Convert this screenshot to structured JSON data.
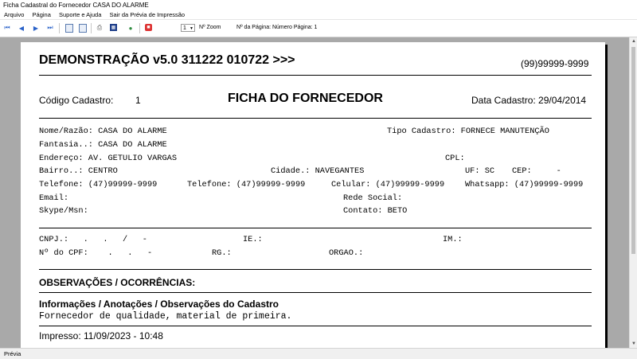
{
  "window": {
    "title": "Ficha Cadastral do Fornecedor CASA DO ALARME"
  },
  "menu": [
    "Arquivo",
    "Página",
    "Suporte e Ajuda",
    "Sair da Prévia de Impressão"
  ],
  "toolbar": {
    "zoom_value": "1",
    "zoom_label": "Nº Zoom",
    "page_label": "Nº da Página: Número Página: 1"
  },
  "report": {
    "header_title": "DEMONSTRAÇÃO v5.0 311222 010722 >>>",
    "header_phone": "(99)99999-9999",
    "codigo_label": "Código Cadastro:",
    "codigo_value": "1",
    "ficha_title": "FICHA DO FORNECEDOR",
    "data_cadastro": "Data Cadastro: 29/04/2014",
    "nome": "Nome/Razão: CASA DO ALARME",
    "tipo_cadastro": "Tipo Cadastro: FORNECE MANUTENÇÃO",
    "fantasia": "Fantasia..: CASA DO ALARME",
    "endereco": "Endereço: AV. GETULIO VARGAS",
    "cpl": "CPL:",
    "bairro": "Bairro..: CENTRO",
    "cidade": "Cidade.: NAVEGANTES",
    "uf": "UF: SC",
    "cep": "CEP:     -",
    "telefone1": "Telefone: (47)99999-9999",
    "telefone2": "Telefone: (47)99999-9999",
    "celular": "Celular: (47)99999-9999",
    "whatsapp": "Whatsapp: (47)99999-9999",
    "email": "Email:",
    "rede_social": "Rede Social:",
    "skype": "Skype/Msn:",
    "contato": "Contato: BETO",
    "cnpj": "CNPJ.:   .   .   /   -",
    "ie": "IE.:",
    "im": "IM.:",
    "cpf": "Nº do CPF:    .   .   -",
    "rg": "RG.:",
    "orgao": "ORGAO.:",
    "obs_title": "OBSERVAÇÕES / OCORRÊNCIAS:",
    "info_title": "Informações / Anotações / Observações do Cadastro",
    "info_text": "Fornecedor de qualidade, material de primeira.",
    "impresso": "Impresso: 11/09/2023 - 10:48"
  },
  "status": {
    "text": "Prévia"
  },
  "icons": [
    "first-page-icon",
    "prev-page-icon",
    "next-page-icon",
    "last-page-icon",
    "single-page-icon",
    "multi-page-icon",
    "printer-icon",
    "grid-icon",
    "export-icon",
    "stop-icon"
  ]
}
